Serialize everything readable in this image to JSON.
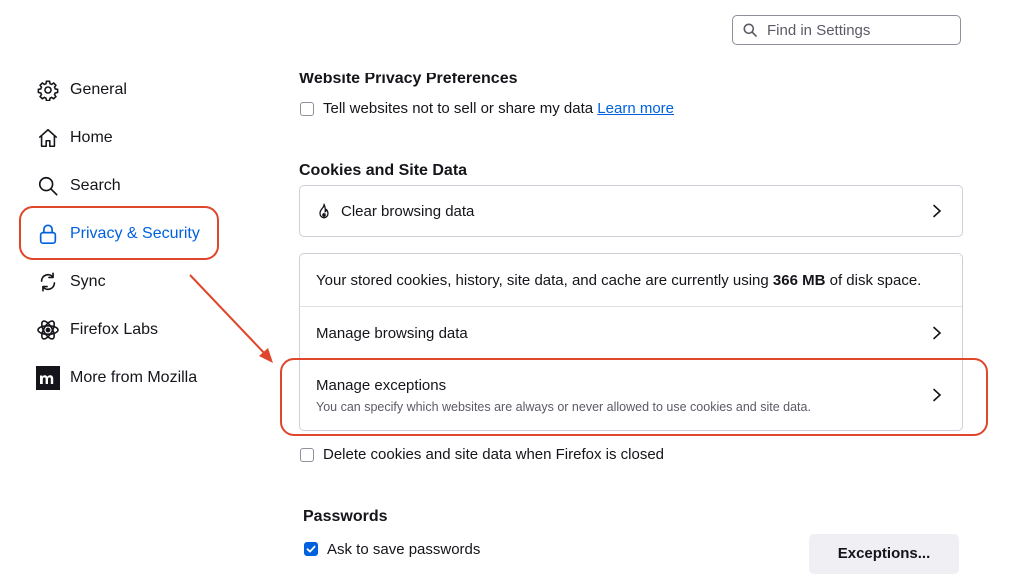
{
  "search": {
    "placeholder": "Find in Settings",
    "value": ""
  },
  "sidebar": {
    "items": [
      {
        "label": "General",
        "icon": "gear-icon"
      },
      {
        "label": "Home",
        "icon": "home-icon"
      },
      {
        "label": "Search",
        "icon": "search-icon"
      },
      {
        "label": "Privacy & Security",
        "icon": "lock-icon",
        "active": true
      },
      {
        "label": "Sync",
        "icon": "sync-icon"
      },
      {
        "label": "Firefox Labs",
        "icon": "atom-icon"
      },
      {
        "label": "More from Mozilla",
        "icon": "mozilla-m-icon"
      }
    ]
  },
  "privacy_prefs": {
    "title": "Website Privacy Preferences",
    "dnt_label": "Tell websites not to sell or share my data",
    "dnt_checked": false,
    "learn_more": "Learn more"
  },
  "cookies": {
    "title": "Cookies and Site Data",
    "clear_label": "Clear browsing data",
    "usage_before": "Your stored cookies, history, site data, and cache are currently using ",
    "usage_amount": "366 MB",
    "usage_after": " of disk space.",
    "manage_data_label": "Manage browsing data",
    "manage_exceptions_label": "Manage exceptions",
    "manage_exceptions_desc": "You can specify which websites are always or never allowed to use cookies and site data.",
    "delete_on_close_label": "Delete cookies and site data when Firefox is closed",
    "delete_on_close_checked": false
  },
  "passwords": {
    "title": "Passwords",
    "ask_save_label": "Ask to save passwords",
    "ask_save_checked": true,
    "exceptions_button": "Exceptions..."
  },
  "colors": {
    "accent": "#0061e0",
    "annotation": "#e0462b"
  }
}
